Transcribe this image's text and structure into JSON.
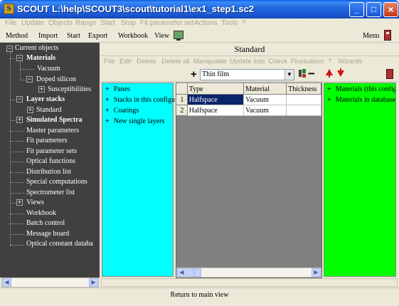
{
  "window": {
    "title": "SCOUT L:\\help\\SCOUT3\\scout\\tutorial1\\ex1_step1.sc2",
    "icon_letter": "S"
  },
  "menu1": [
    "File",
    "Update",
    "Objects",
    "Range",
    "Start",
    "Stop",
    "Fit parameter set",
    "Actions",
    "Tools",
    "?"
  ],
  "menu2": {
    "method": "Method",
    "import": "Import",
    "start": "Start",
    "export": "Export",
    "workbook": "Workbook",
    "view": "View",
    "menu": "Menu"
  },
  "tree": {
    "current_objects": "Current objects",
    "materials": "Materials",
    "vacuum": "Vacuum",
    "doped_silicon": "Doped silicon",
    "susceptibilities": "Susceptibilities",
    "layer_stacks": "Layer stacks",
    "standard": "Standard",
    "simulated_spectra": "Simulated Spectra",
    "master_parameters": "Master parameters",
    "fit_parameters": "Fit parameters",
    "fit_parameter_sets": "Fit parameter sets",
    "optical_functions": "Optical functions",
    "distribution_list": "Distribution list",
    "special_computations": "Special computations",
    "spectrometer_list": "Spectrometer list",
    "views": "Views",
    "workbook": "Workbook",
    "batch_control": "Batch control",
    "message_board": "Message board",
    "optical_constant_database": "Optical constant databa"
  },
  "main": {
    "header": "Standard",
    "toolbar": [
      "File",
      "Edit",
      "Delete",
      "Delete all",
      "Manipulate",
      "Update lists",
      "Check",
      "Fluctuation",
      "?",
      "Wizards"
    ],
    "combo_value": "Thin film"
  },
  "left_list": [
    "Panes",
    "Stacks in this configu",
    "Coatings",
    "New single layers"
  ],
  "right_list": [
    "Materials (this config",
    "Materials in database"
  ],
  "grid": {
    "columns": [
      "Type",
      "Material",
      "Thickness"
    ],
    "rows": [
      {
        "idx": "1",
        "type": "Halfspace",
        "material": "Vacuum",
        "thickness": ""
      },
      {
        "idx": "2",
        "type": "Halfspace",
        "material": "Vacuum",
        "thickness": ""
      }
    ]
  },
  "status": "Return to main view"
}
